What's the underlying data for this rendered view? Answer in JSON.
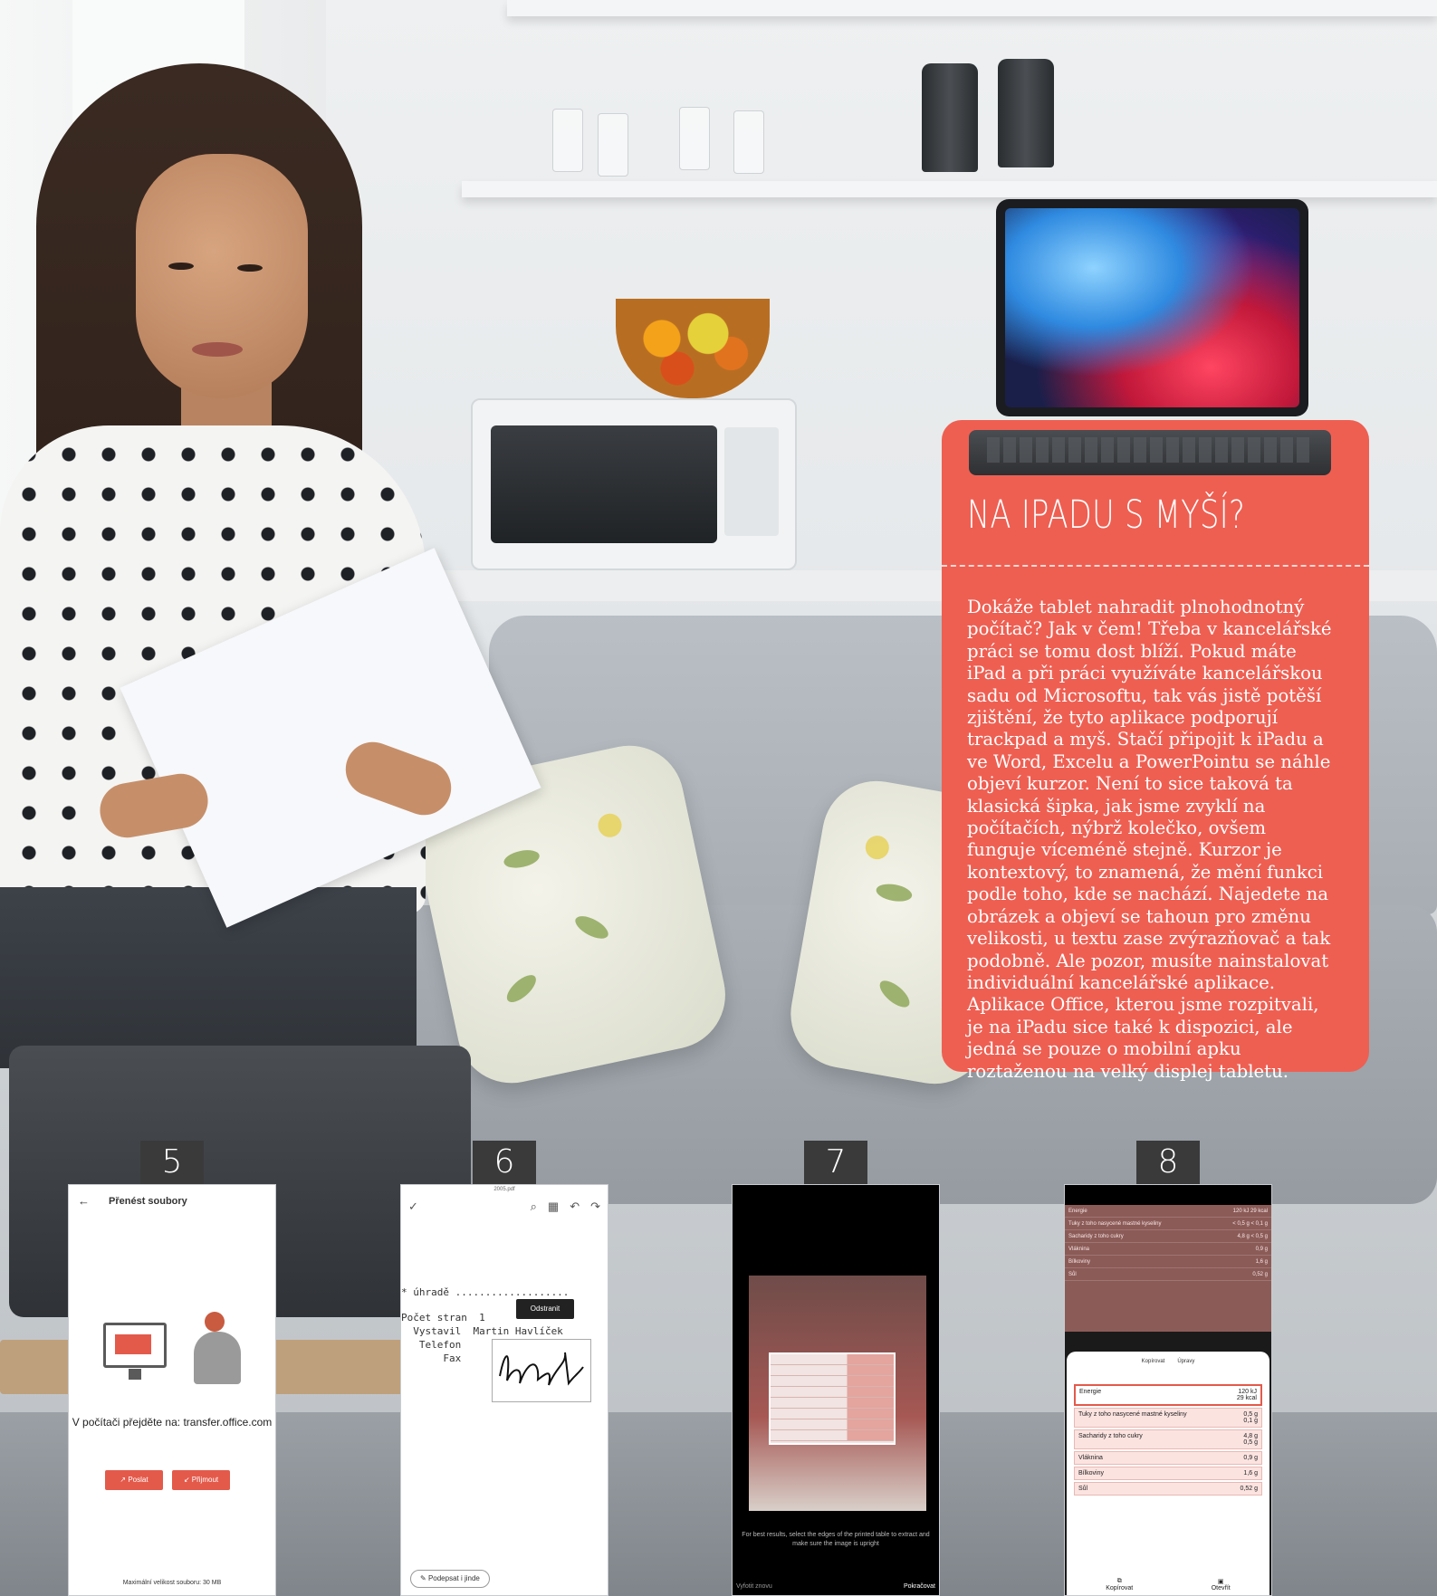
{
  "sidebar": {
    "title": "NA IPADU S MYŠÍ?",
    "body": "Dokáže tablet nahradit plnohodnotný počítač? Jak v čem! Třeba v kancelářské práci se tomu dost blíží. Pokud máte iPad a při práci využíváte kancelářskou sadu od Microsoftu, tak vás jistě potěší zjištění, že tyto aplikace podporují trackpad a myš. Stačí připojit k iPadu a ve Word, Excelu a PowerPointu se náhle objeví kurzor. Není to sice taková ta klasická šipka, jak jsme zvyklí na počítačích, nýbrž kolečko, ovšem funguje víceméně stejně. Kurzor je kontextový, to znamená, že mění funkci podle toho, kde se nachází. Najedete na obrázek a objeví se tahoun pro změnu velikosti, u textu zase zvýrazňovač a tak podobně. Ale pozor, musíte nainstalovat individuální kancelářské aplikace. Aplikace Office, kterou jsme rozpitvali, je na iPadu sice také k dispozici, ale jedná se pouze o mobilní apku roztaženou na velký displej tabletu.",
    "accent_color": "#ee5f52"
  },
  "steps": [
    {
      "number": "5"
    },
    {
      "number": "6"
    },
    {
      "number": "7"
    },
    {
      "number": "8"
    }
  ],
  "phone5": {
    "title": "Přenést soubory",
    "message": "V počítači přejděte na: transfer.office.com",
    "send": "Poslat",
    "receive": "Přijmout",
    "footer": "Maximální velikost souboru: 30 MB"
  },
  "phone6": {
    "filename": "2005.pdf",
    "line1": "* úhradě ...................",
    "line2": "Počet stran  1",
    "line3": "  Vystavil  Martin Havlíček",
    "line4": "   Telefon",
    "line5": "       Fax",
    "remove": "Odstranit",
    "sign_elsewhere": "Podepsat i jinde"
  },
  "phone7": {
    "caption": "For best results, select the edges of the printed table to extract and make sure the image is upright",
    "retake": "Vyfotit znovu",
    "continue": "Pokračovat"
  },
  "phone8": {
    "dark_rows": [
      {
        "label": "Energie",
        "value": "120 kJ 29 kcal"
      },
      {
        "label": "Tuky z toho nasycené mastné kyseliny",
        "value": "< 0,5 g < 0,1 g"
      },
      {
        "label": "Sacharidy z toho cukry",
        "value": "4,8 g < 0,5 g"
      },
      {
        "label": "Vláknina",
        "value": "0,9 g"
      },
      {
        "label": "Bílkoviny",
        "value": "1,6 g"
      },
      {
        "label": "Sůl",
        "value": "0,52 g"
      }
    ],
    "tabs": [
      "Kopírovat",
      "Úpravy"
    ],
    "rows": [
      {
        "label": "Energie",
        "value": "120 kJ\n29 kcal"
      },
      {
        "label": "Tuky z toho nasycené mastné kyseliny",
        "value": "0,5 g\n0,1 g"
      },
      {
        "label": "Sacharidy z toho cukry",
        "value": "4,8 g\n0,5 g"
      },
      {
        "label": "Vláknina",
        "value": "0,9 g"
      },
      {
        "label": "Bílkoviny",
        "value": "1,6 g"
      },
      {
        "label": "Sůl",
        "value": "0,52 g"
      }
    ],
    "copy": "Kopírovat",
    "open": "Otevřít"
  }
}
